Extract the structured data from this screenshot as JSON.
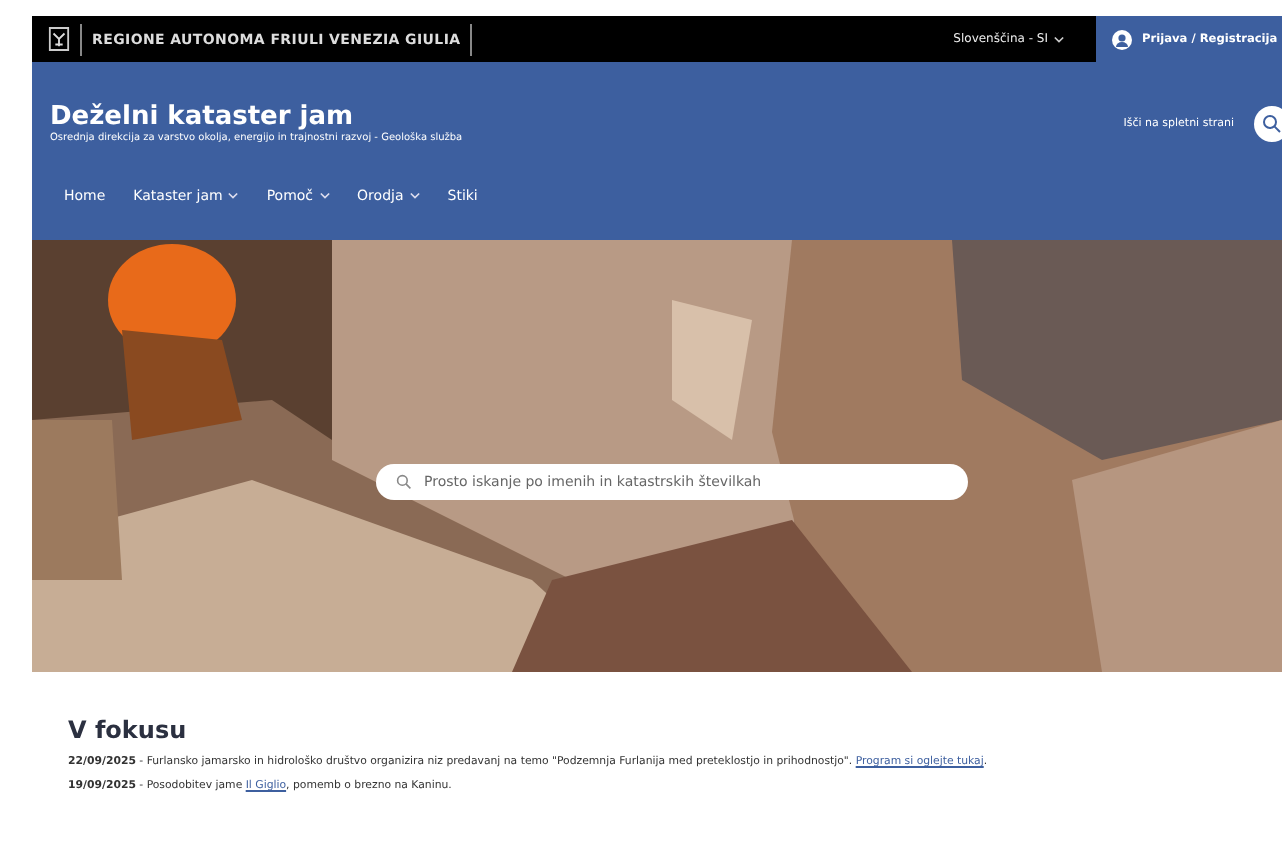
{
  "topbar": {
    "region": "REGIONE AUTONOMA FRIULI VENEZIA GIULIA",
    "language": "Slovenščina - SI",
    "login": "Prijava / Registracija"
  },
  "header": {
    "title": "Deželni kataster jam",
    "subtitle": "Osrednja direkcija za varstvo okolja, energijo in trajnostni razvoj - Geološka služba",
    "search_label": "Išči na spletni strani"
  },
  "nav": [
    {
      "label": "Home",
      "dropdown": false
    },
    {
      "label": "Kataster jam",
      "dropdown": true
    },
    {
      "label": "Pomoč",
      "dropdown": true
    },
    {
      "label": "Orodja",
      "dropdown": true
    },
    {
      "label": "Stiki",
      "dropdown": false
    }
  ],
  "hero": {
    "kind": "picture",
    "search": {
      "placeholder": "Prosto iskanje po imenih in katastrskih številkah"
    }
  },
  "focus": {
    "title": "V fokusu",
    "items": [
      {
        "date": "22/09/2025",
        "text": " - Furlansko jamarsko in hidrološko društvo organizira niz predavanj na temo \"Podzemnja Furlanija med preteklostjo in prihodnostjo\". ",
        "link": "Program si oglejte tukaj",
        "after": "."
      },
      {
        "date": "19/09/2025",
        "text": " - Posodobitev jame ",
        "link": "Il Giglio",
        "after": ", pomemb o brezno na Kaninu."
      }
    ]
  }
}
